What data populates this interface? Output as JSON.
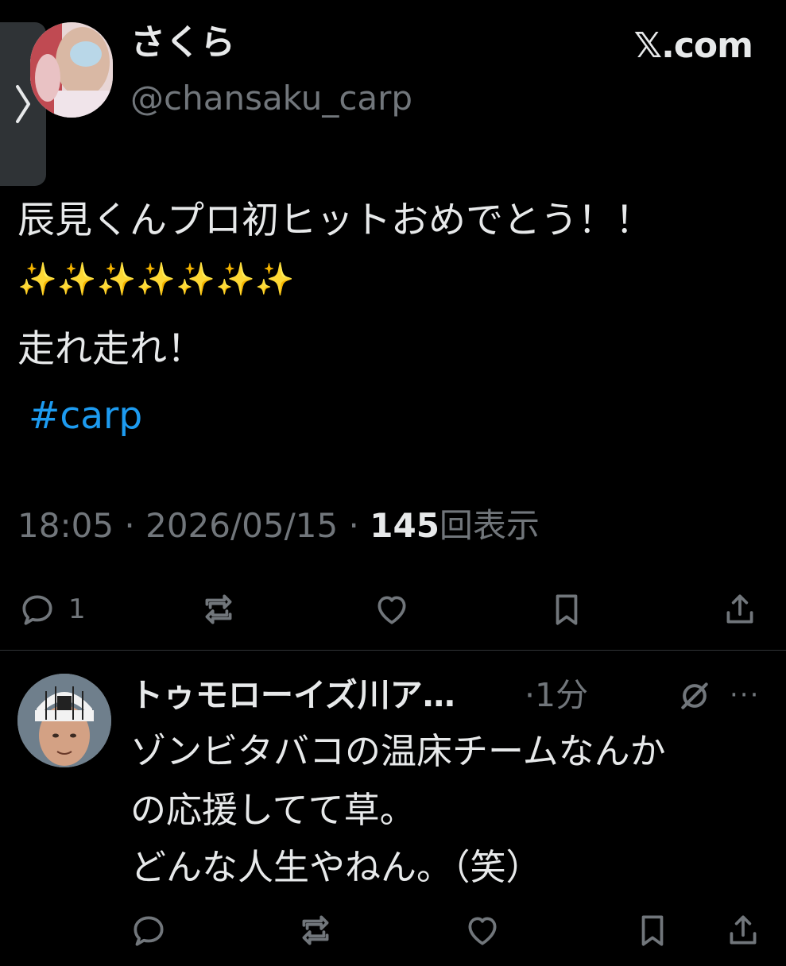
{
  "header": {
    "display_name": "さくら",
    "handle": "@chansaku_carp",
    "source": "𝕏.com"
  },
  "tweet": {
    "line1": "辰見くんプロ初ヒットおめでとう！！",
    "line2": "✨✨✨✨✨✨✨",
    "line3": "走れ走れ！",
    "hashtag": "#carp"
  },
  "meta": {
    "time": "18:05",
    "separator": " · ",
    "date": "2026/05/15",
    "views_count": "145",
    "views_label": "回表示"
  },
  "actions": {
    "reply_count": "1"
  },
  "reply": {
    "name": "トゥモローイズ川ア…",
    "time": "·1分",
    "more": "···",
    "line1": "ゾンビタバコの温床チームなんか",
    "line2": "の応援してて草。",
    "line3": "どんな人生やねん。（笑）"
  },
  "colors": {
    "background": "#000000",
    "text": "#e7e9ea",
    "muted": "#71767b",
    "link": "#1d9bf0"
  }
}
